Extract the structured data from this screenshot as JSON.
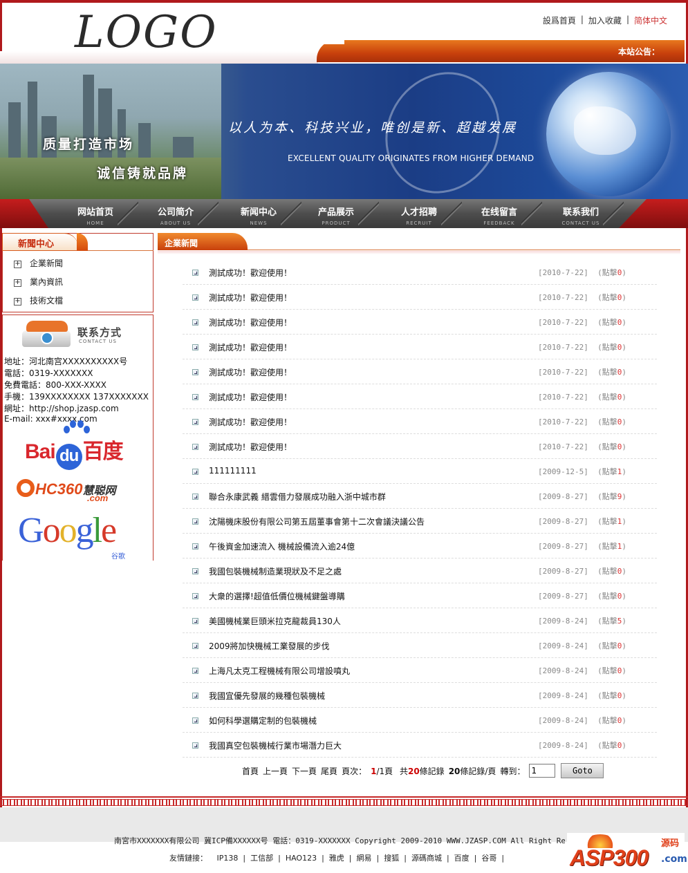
{
  "header": {
    "logo": "LOGO",
    "links": [
      "設爲首頁",
      "加入收藏",
      "简体中文"
    ],
    "notice_label": "本站公告："
  },
  "banner": {
    "slogan_cn": "以人为本、科技兴业，唯创是新、超越发展",
    "slogan_en": "EXCELLENT QUALITY ORIGINATES FROM HIGHER DEMAND",
    "slogan_left_1": "质量打造市场",
    "slogan_left_2": "诚信铸就品牌"
  },
  "nav": [
    {
      "cn": "网站首页",
      "en": "HOME"
    },
    {
      "cn": "公司简介",
      "en": "ABOUT US"
    },
    {
      "cn": "新闻中心",
      "en": "NEWS"
    },
    {
      "cn": "产品展示",
      "en": "PRODUCT"
    },
    {
      "cn": "人才招聘",
      "en": "RECRUIT"
    },
    {
      "cn": "在线留言",
      "en": "FEEDBACK"
    },
    {
      "cn": "联系我们",
      "en": "CONTACT US"
    }
  ],
  "sidebar": {
    "title": "新聞中心",
    "items": [
      "企業新聞",
      "業內資訊",
      "技術文檔"
    ],
    "contact": {
      "title": "联系方式",
      "subtitle": "CONTACT US",
      "lines": [
        "地址：河北南宫XXXXXXXXXX号",
        "電話：0319-XXXXXXX",
        "免費電話：800-XXX-XXXX",
        "手機：139XXXXXXXX 137XXXXXXX",
        "網址：http://shop.jzasp.com",
        "E-mail: xxx#xxxx.com"
      ]
    },
    "partners": {
      "baidu_a": "Bai",
      "baidu_du": "du",
      "baidu_cn": "百度",
      "hc360_a": "HC360",
      "hc360_cn": "慧聪网",
      "hc360_com": ".com",
      "google_sub": "谷歌"
    }
  },
  "main": {
    "tab_title": "企業新聞",
    "news": [
      {
        "title": "測試成功！歡迎使用！",
        "date": "[2010-7-22]",
        "clicks": "0"
      },
      {
        "title": "測試成功！歡迎使用！",
        "date": "[2010-7-22]",
        "clicks": "0"
      },
      {
        "title": "測試成功！歡迎使用！",
        "date": "[2010-7-22]",
        "clicks": "0"
      },
      {
        "title": "測試成功！歡迎使用！",
        "date": "[2010-7-22]",
        "clicks": "0"
      },
      {
        "title": "測試成功！歡迎使用！",
        "date": "[2010-7-22]",
        "clicks": "0"
      },
      {
        "title": "測試成功！歡迎使用！",
        "date": "[2010-7-22]",
        "clicks": "0"
      },
      {
        "title": "測試成功！歡迎使用！",
        "date": "[2010-7-22]",
        "clicks": "0"
      },
      {
        "title": "測試成功！歡迎使用！",
        "date": "[2010-7-22]",
        "clicks": "0"
      },
      {
        "title": "111111111",
        "date": "[2009-12-5]",
        "clicks": "1"
      },
      {
        "title": "聯合永康武義 縉雲借力發展成功融入浙中城市群",
        "date": "[2009-8-27]",
        "clicks": "9"
      },
      {
        "title": "沈陽機床股份有限公司第五屆董事會第十二次會議決議公告",
        "date": "[2009-8-27]",
        "clicks": "1"
      },
      {
        "title": "午後資金加速流入 機械設備流入逾24億",
        "date": "[2009-8-27]",
        "clicks": "1"
      },
      {
        "title": "我國包裝機械制造業現狀及不足之處",
        "date": "[2009-8-27]",
        "clicks": "0"
      },
      {
        "title": "大衆的選擇!超值低價位機械鍵盤導購",
        "date": "[2009-8-27]",
        "clicks": "0"
      },
      {
        "title": "美國機械業巨頭米拉克龍裁員130人",
        "date": "[2009-8-24]",
        "clicks": "5"
      },
      {
        "title": "2009將加快機械工業發展的步伐",
        "date": "[2009-8-24]",
        "clicks": "0"
      },
      {
        "title": "上海凡太克工程機械有限公司增設噴丸",
        "date": "[2009-8-24]",
        "clicks": "0"
      },
      {
        "title": "我國宜優先發展的幾種包裝機械",
        "date": "[2009-8-24]",
        "clicks": "0"
      },
      {
        "title": "如何科學選購定制的包裝機械",
        "date": "[2009-8-24]",
        "clicks": "0"
      },
      {
        "title": "我國真空包裝機械行業市場潛力巨大",
        "date": "[2009-8-24]",
        "clicks": "0"
      }
    ],
    "clicks_prefix": "(點擊",
    "clicks_suffix": ")",
    "pager": {
      "first": "首頁",
      "prev": "上一頁",
      "next": "下一頁",
      "last": "尾頁",
      "page_label": "頁次：",
      "current": "1",
      "total_pages": "/1頁",
      "total_label": "共",
      "total_records": "20",
      "records_label": "條記錄",
      "per_page": "20",
      "per_page_label": "條記錄/頁",
      "goto_label": "轉到：",
      "goto_value": "1",
      "goto_button": "Goto"
    }
  },
  "footer": {
    "text": "南宮市XXXXXXX有限公司 冀ICP備XXXXXX号 電話：0319-XXXXXXX Copyright 2009-2010 WWW.JZASP.COM  All Right Reserved",
    "links_label": "友情鏈接：",
    "links": [
      "IP138",
      "工信部",
      "HAO123",
      "雅虎",
      "網易",
      "搜狐",
      "源碼商城",
      "百度",
      "谷哥"
    ],
    "watermark": "ASP300",
    "watermark_cn": "源码",
    "watermark_com": ".com"
  }
}
